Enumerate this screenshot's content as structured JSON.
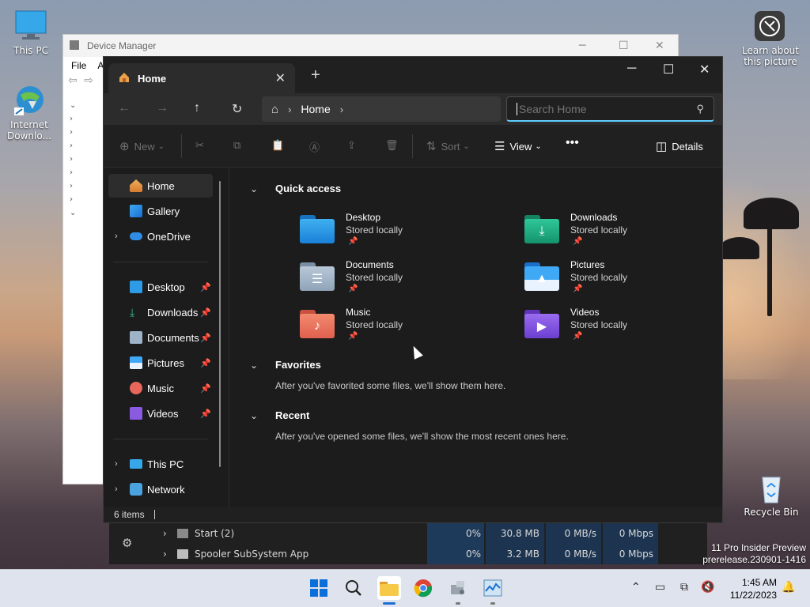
{
  "desktop": {
    "icons": [
      {
        "label": "This PC"
      },
      {
        "label": "Internet Downlo..."
      },
      {
        "label": "Learn about this picture"
      },
      {
        "label": "Recycle Bin"
      }
    ],
    "watermark_line1": "11 Pro Insider Preview",
    "watermark_line2": "prerelease.230901-1416"
  },
  "device_manager": {
    "title": "Device Manager",
    "menu_file": "File",
    "menu_partial": "A"
  },
  "task_manager": {
    "rows": [
      {
        "name": "Start (2)",
        "cpu": "0%",
        "memory": "30.8 MB",
        "disk": "0 MB/s",
        "network": "0 Mbps"
      },
      {
        "name": "Spooler SubSystem App",
        "cpu": "0%",
        "memory": "3.2 MB",
        "disk": "0 MB/s",
        "network": "0 Mbps"
      }
    ]
  },
  "explorer": {
    "tab_label": "Home",
    "address": {
      "current": "Home"
    },
    "search": {
      "placeholder": "Search Home"
    },
    "commands": {
      "new": "New",
      "sort": "Sort",
      "view": "View",
      "details": "Details"
    },
    "nav": {
      "home": "Home",
      "gallery": "Gallery",
      "onedrive": "OneDrive",
      "desktop": "Desktop",
      "downloads": "Downloads",
      "documents": "Documents",
      "pictures": "Pictures",
      "music": "Music",
      "videos": "Videos",
      "thispc": "This PC",
      "network": "Network"
    },
    "quick_access": {
      "title": "Quick access",
      "items": [
        {
          "name": "Desktop",
          "sub": "Stored locally"
        },
        {
          "name": "Downloads",
          "sub": "Stored locally"
        },
        {
          "name": "Documents",
          "sub": "Stored locally"
        },
        {
          "name": "Pictures",
          "sub": "Stored locally"
        },
        {
          "name": "Music",
          "sub": "Stored locally"
        },
        {
          "name": "Videos",
          "sub": "Stored locally"
        }
      ]
    },
    "favorites": {
      "title": "Favorites",
      "message": "After you've favorited some files, we'll show them here."
    },
    "recent": {
      "title": "Recent",
      "message": "After you've opened some files, we'll show the most recent ones here."
    },
    "status": "6 items"
  },
  "taskbar": {
    "time": "1:45 AM",
    "date": "11/22/2023"
  },
  "colors": {
    "accent": "#60cdff",
    "desktop_folder": "#1f8fdf",
    "downloads_folder": "#1ba37a",
    "documents_folder": "#8fa3b8",
    "pictures_folder": "#2f8de8",
    "music_folder": "#e8675a",
    "videos_folder": "#7a4fd6"
  }
}
